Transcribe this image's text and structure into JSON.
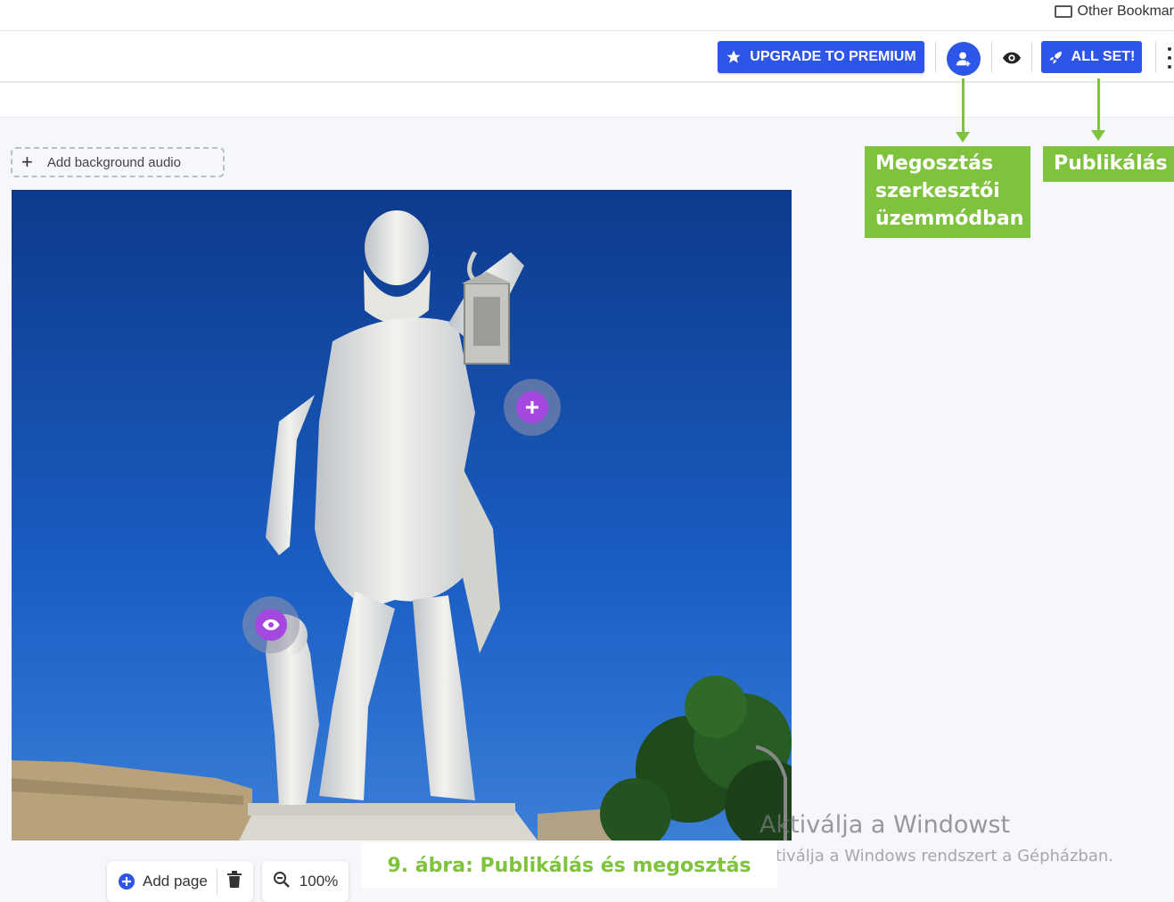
{
  "browser": {
    "bookmark_folder": "Other Bookmar"
  },
  "toolbar": {
    "premium_label": "UPGRADE TO PREMIUM",
    "allset_label": "ALL SET!",
    "accent_color": "#2d55e8"
  },
  "editor": {
    "audio_label": "Add background audio",
    "hotspot_color": "#a548e0"
  },
  "annotations": {
    "share": [
      "Megosztás",
      "szerkesztői",
      "üzemmódban"
    ],
    "publish": "Publikálás",
    "caption": "9. ábra: Publikálás és megosztás",
    "color": "#7fc23e"
  },
  "bottom_toolbar": {
    "add_page_label": "Add page",
    "zoom_value": "100%"
  },
  "watermark": {
    "title": "Aktiválja a Windowst",
    "subtitle": "tiválja a Windows rendszert a Gépházban."
  }
}
